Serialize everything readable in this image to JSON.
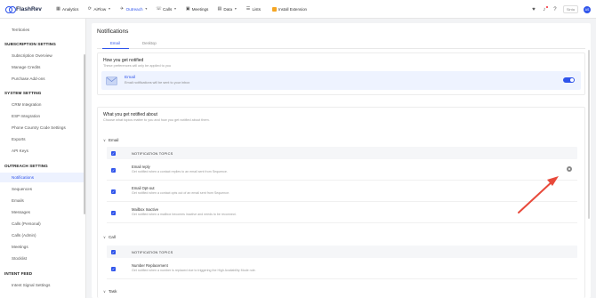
{
  "topbar": {
    "brand": "FlashRev",
    "nav": [
      {
        "label": "Analytics",
        "icon": "analytics-icon"
      },
      {
        "label": "AiFlow",
        "icon": "aiflow-icon",
        "dropdown": true
      },
      {
        "label": "Outreach",
        "icon": "outreach-icon",
        "dropdown": true
      },
      {
        "label": "Calls",
        "icon": "phone-icon",
        "dropdown": true
      },
      {
        "label": "Meetings",
        "icon": "calendar-icon"
      },
      {
        "label": "Data",
        "icon": "data-icon",
        "dropdown": true
      },
      {
        "label": "Lists",
        "icon": "list-icon"
      }
    ],
    "status_label": "Install Extension",
    "user_label": "Sinta",
    "avatar_initials": "AS"
  },
  "sidebar": {
    "items_top": [
      "Territories"
    ],
    "groups": [
      {
        "title": "SUBSCRIPTION SETTING",
        "items": [
          "Subscription Overview",
          "Manage Credits",
          "Purchase Add-ons"
        ]
      },
      {
        "title": "SYSTEM SETTING",
        "items": [
          "CRM Integration",
          "ESP Integration",
          "Phone Country Code Settings",
          "Exports",
          "API Keys"
        ]
      },
      {
        "title": "OUTREACH SETTING",
        "items": [
          "Notifications",
          "Sequences",
          "Emails",
          "Messages",
          "Calls (Personal)",
          "Calls (Admin)",
          "Meetings",
          "Stocklist"
        ]
      },
      {
        "title": "INTENT FEED",
        "items": [
          "Intent Signal Settings"
        ]
      }
    ],
    "active_item": "Notifications"
  },
  "main": {
    "title": "Notifications",
    "tabs": [
      "Email",
      "Desktop"
    ],
    "active_tab": "Email",
    "how": {
      "heading": "How you get notified",
      "sub": "These preferences will only be applied to you",
      "card_title": "Email",
      "card_desc": "Email notifications will be sent to your inbox",
      "toggle_on": true
    },
    "what": {
      "heading": "What you get notified about",
      "sub": "Choose what topics matter to you and how you get notified about them.",
      "groups": [
        {
          "name": "Email",
          "header": "NOTIFICATION TOPICS",
          "rows": [
            {
              "title": "Email reply",
              "desc": "Get notified when a contact replies to an email sent from Sequence."
            },
            {
              "title": "Email Opt-out",
              "desc": "Get notified when a contact opts out of an email sent from Sequence."
            },
            {
              "title": "Mailbox Inactive",
              "desc": "Get notified when a mailbox becomes inactive and needs to be reconnect."
            }
          ]
        },
        {
          "name": "Call",
          "header": "NOTIFICATION TOPICS",
          "rows": [
            {
              "title": "Number Replacement",
              "desc": "Get notified when a number is replaced due to triggering the High Availability Mode rule."
            }
          ]
        },
        {
          "name": "Task",
          "header": "",
          "rows": []
        }
      ]
    }
  },
  "colors": {
    "accent": "#2f54eb",
    "annotation_arrow": "#e8493a"
  }
}
